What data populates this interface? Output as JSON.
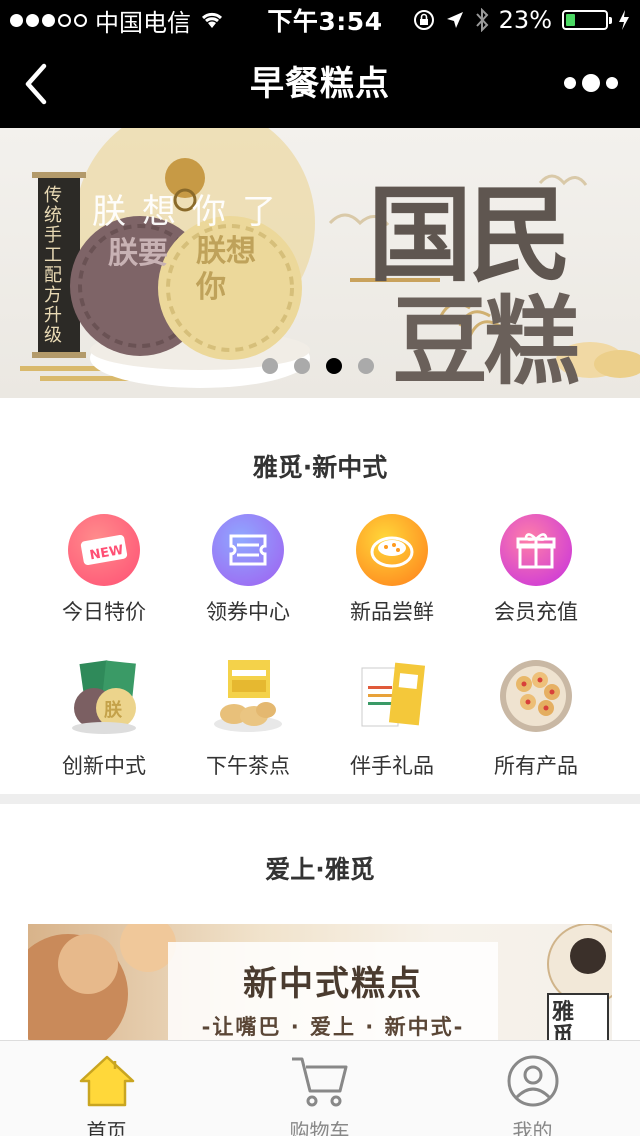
{
  "status_bar": {
    "carrier": "中国电信",
    "time": "下午3:54",
    "battery": "23%",
    "battery_level": 0.23,
    "icons": [
      "signal-dots",
      "wifi-icon",
      "orientation-lock-icon",
      "location-icon",
      "bluetooth-icon",
      "battery-icon",
      "charging-icon"
    ]
  },
  "nav": {
    "title": "早餐糕点",
    "back_icon": "back-chevron-icon",
    "more_icon": "more-dots-icon"
  },
  "banner": {
    "left_scroll_text": "传统手工 配方升级",
    "arc_text": "朕想你了",
    "cake1_text": "朕要",
    "cake2_text": "朕想你",
    "headline_top": "国民",
    "headline_bottom": "豆糕",
    "page_count": 4,
    "active_page": 3
  },
  "section1": {
    "title": "雅觅·新中式",
    "items": [
      {
        "label": "今日特价",
        "icon": "new-tag-icon",
        "color": "#ff6b7d"
      },
      {
        "label": "领券中心",
        "icon": "coupon-icon",
        "color": "#8a7cf0"
      },
      {
        "label": "新品尝鲜",
        "icon": "cake-plate-icon",
        "color": "#ff9a1e"
      },
      {
        "label": "会员充值",
        "icon": "gift-box-icon",
        "color": "#d43bd4"
      },
      {
        "label": "创新中式",
        "icon": "mooncake-product-image"
      },
      {
        "label": "下午茶点",
        "icon": "pastry-box-product-image"
      },
      {
        "label": "伴手礼品",
        "icon": "gift-packs-product-image"
      },
      {
        "label": "所有产品",
        "icon": "cookie-plate-product-image"
      }
    ],
    "cake_stamp": "朕"
  },
  "section2": {
    "title": "爱上·雅觅",
    "promo_title": "新中式糕点",
    "promo_sub": "-让嘴巴 · 爱上 · 新中式-",
    "promo_tag": "雅觅"
  },
  "tab_bar": {
    "tabs": [
      {
        "label": "首页",
        "icon": "home-icon",
        "active": true
      },
      {
        "label": "购物车",
        "icon": "cart-icon",
        "active": false
      },
      {
        "label": "我的",
        "icon": "user-icon",
        "active": false
      }
    ],
    "active_color": "#ffd83a"
  }
}
